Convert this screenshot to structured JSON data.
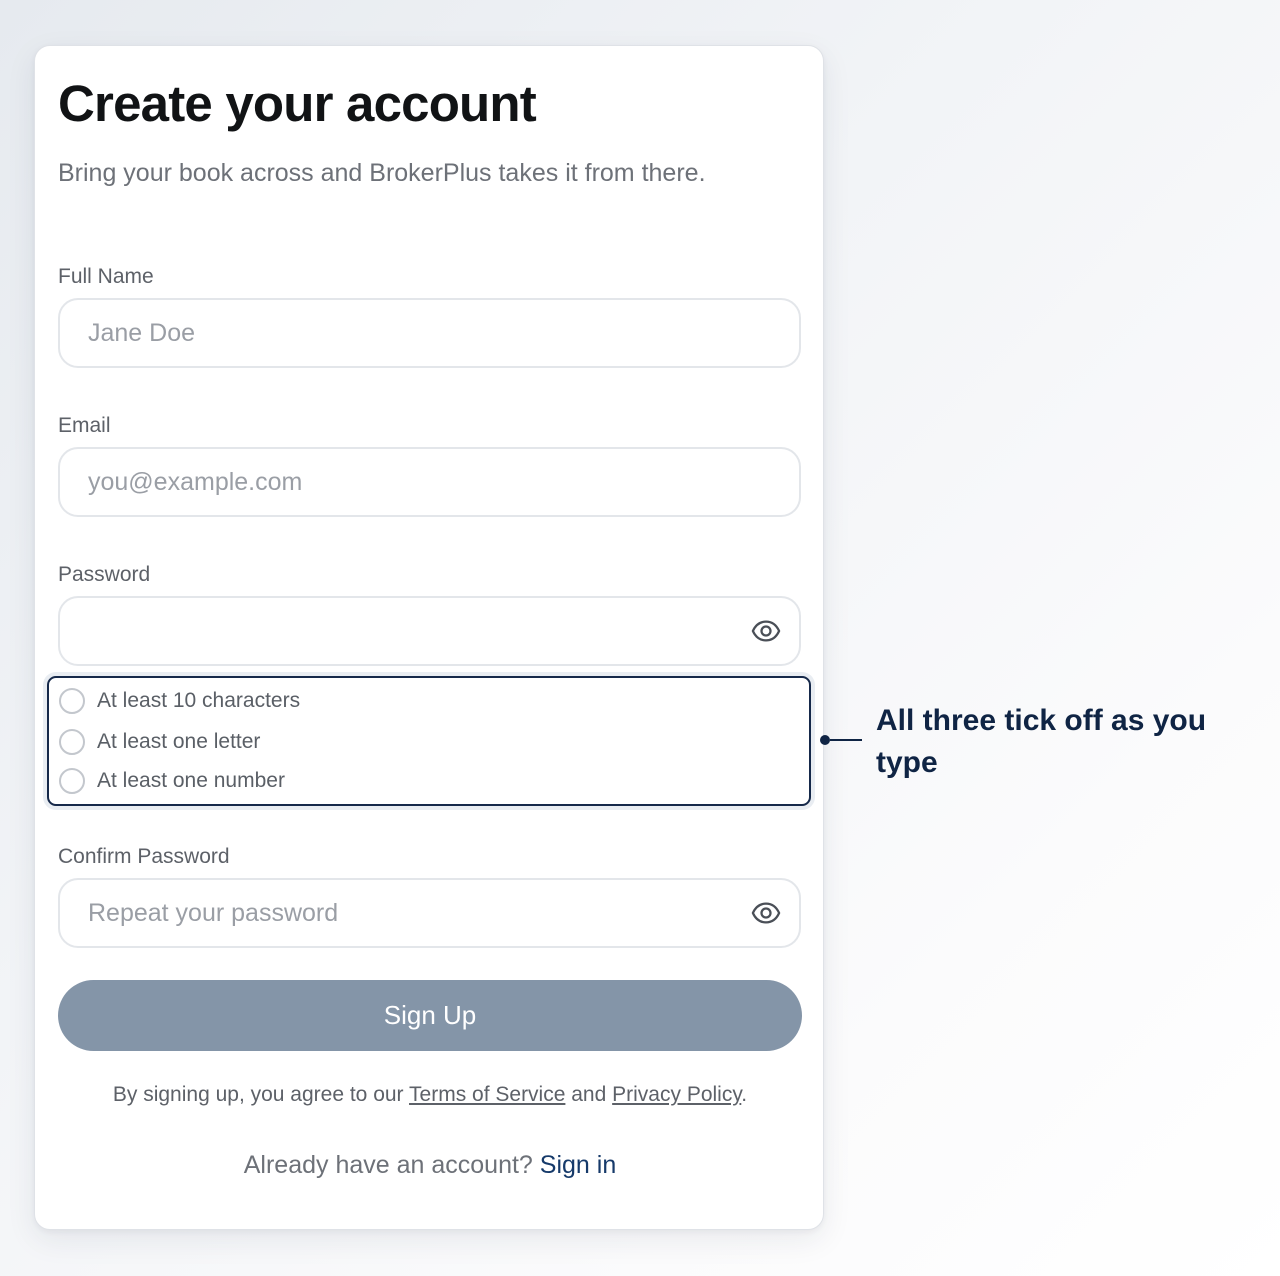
{
  "form": {
    "title": "Create your account",
    "subtitle": "Bring your book across and BrokerPlus takes it from there.",
    "full_name": {
      "label": "Full Name",
      "placeholder": "Jane Doe"
    },
    "email": {
      "label": "Email",
      "placeholder": "you@example.com"
    },
    "password": {
      "label": "Password",
      "placeholder": "",
      "toggle_icon": "eye-icon"
    },
    "requirements": [
      {
        "label": "At least 10 characters",
        "met": false
      },
      {
        "label": "At least one letter",
        "met": false
      },
      {
        "label": "At least one number",
        "met": false
      }
    ],
    "confirm_password": {
      "label": "Confirm Password",
      "placeholder": "Repeat your password",
      "toggle_icon": "eye-icon"
    },
    "submit_label": "Sign Up",
    "legal": {
      "prefix": "By signing up, you agree to our",
      "terms_link": "Terms of Service",
      "joiner": "and",
      "privacy_link": "Privacy Policy",
      "suffix": "."
    },
    "signin": {
      "prompt": "Already have an account?",
      "link": "Sign in"
    }
  },
  "annotation": {
    "text": "All three tick off as you type"
  },
  "colors": {
    "accent": "#163a6a",
    "button_disabled": "#8495a8",
    "highlight_border": "#16294a"
  }
}
